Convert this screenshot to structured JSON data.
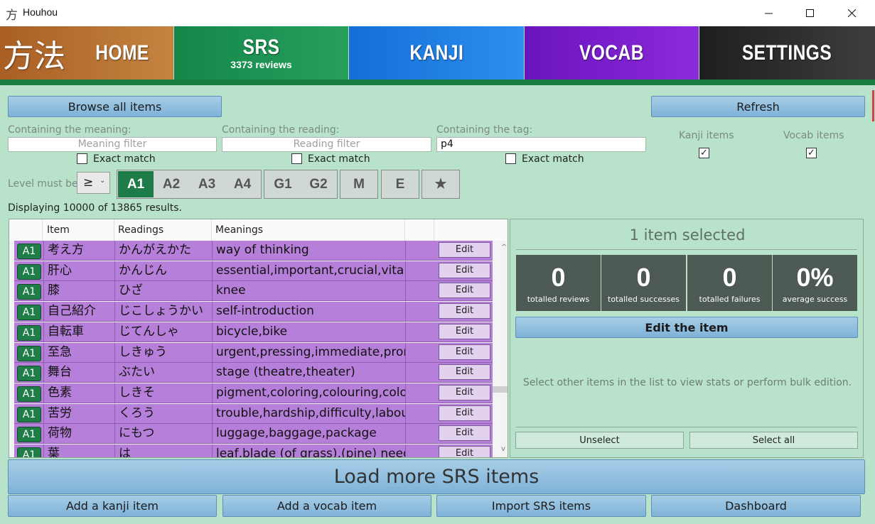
{
  "window": {
    "icon_glyph": "方",
    "title": "Houhou",
    "controls": [
      "minimize-icon",
      "maximize-icon",
      "close-icon"
    ]
  },
  "nav": {
    "logo": "方法",
    "tabs": [
      {
        "label": "HOME",
        "color": "#b87234"
      },
      {
        "label": "SRS",
        "sub": "3373 reviews",
        "color": "#1c9350"
      },
      {
        "label": "KANJI",
        "color": "#1a82e0"
      },
      {
        "label": "VOCAB",
        "color": "#7a1cc8"
      },
      {
        "label": "SETTINGS",
        "color": "#303030"
      }
    ]
  },
  "toolbar": {
    "browse_label": "Browse all items",
    "refresh_label": "Refresh"
  },
  "filters": {
    "meaning": {
      "label": "Containing the meaning:",
      "placeholder": "Meaning filter",
      "value": "",
      "exact_label": "Exact match",
      "exact_checked": false
    },
    "reading": {
      "label": "Containing the reading:",
      "placeholder": "Reading filter",
      "value": "",
      "exact_label": "Exact match",
      "exact_checked": false
    },
    "tag": {
      "label": "Containing the tag:",
      "value": "p4",
      "exact_label": "Exact match",
      "exact_checked": false
    },
    "kanji_items": {
      "label": "Kanji items",
      "checked": true
    },
    "vocab_items": {
      "label": "Vocab items",
      "checked": true
    }
  },
  "level": {
    "label": "Level must be",
    "operator": "≥",
    "groups": [
      [
        "A1",
        "A2",
        "A3",
        "A4"
      ],
      [
        "G1",
        "G2"
      ],
      [
        "M"
      ],
      [
        "E"
      ],
      [
        "★"
      ]
    ],
    "selected": "A1"
  },
  "results_text": "Displaying 10000 of 13865 results.",
  "table": {
    "headers": [
      "Item",
      "Readings",
      "Meanings"
    ],
    "edit_label": "Edit",
    "rows": [
      {
        "level": "A1",
        "item": "考え方",
        "reading": "かんがえかた",
        "meaning": "way of thinking"
      },
      {
        "level": "A1",
        "item": "肝心",
        "reading": "かんじん",
        "meaning": "essential,important,crucial,vital,ma"
      },
      {
        "level": "A1",
        "item": "膝",
        "reading": "ひざ",
        "meaning": "knee"
      },
      {
        "level": "A1",
        "item": "自己紹介",
        "reading": "じこしょうかい",
        "meaning": "self-introduction"
      },
      {
        "level": "A1",
        "item": "自転車",
        "reading": "じてんしゃ",
        "meaning": "bicycle,bike"
      },
      {
        "level": "A1",
        "item": "至急",
        "reading": "しきゅう",
        "meaning": "urgent,pressing,immediate,prompt"
      },
      {
        "level": "A1",
        "item": "舞台",
        "reading": "ぶたい",
        "meaning": "stage (theatre,theater)"
      },
      {
        "level": "A1",
        "item": "色素",
        "reading": "しきそ",
        "meaning": "pigment,coloring,colouring,colorant"
      },
      {
        "level": "A1",
        "item": "苦労",
        "reading": "くろう",
        "meaning": "trouble,hardship,difficulty,labour,la"
      },
      {
        "level": "A1",
        "item": "荷物",
        "reading": "にもつ",
        "meaning": "luggage,baggage,package"
      },
      {
        "level": "A1",
        "item": "葉",
        "reading": "は",
        "meaning": "leaf,blade (of grass),(pine) needle"
      }
    ]
  },
  "selection": {
    "title": "1 item selected",
    "stats": [
      {
        "value": "0",
        "caption": "totalled reviews"
      },
      {
        "value": "0",
        "caption": "totalled successes"
      },
      {
        "value": "0",
        "caption": "totalled failures"
      },
      {
        "value": "0%",
        "caption": "average success"
      }
    ],
    "edit_label": "Edit the item",
    "hint": "Select other items in the list to view stats or perform bulk edition.",
    "unselect_label": "Unselect",
    "select_all_label": "Select all"
  },
  "footer": {
    "load_more_label": "Load more SRS items",
    "add_kanji_label": "Add a kanji item",
    "add_vocab_label": "Add a vocab item",
    "import_label": "Import SRS items",
    "dashboard_label": "Dashboard"
  }
}
